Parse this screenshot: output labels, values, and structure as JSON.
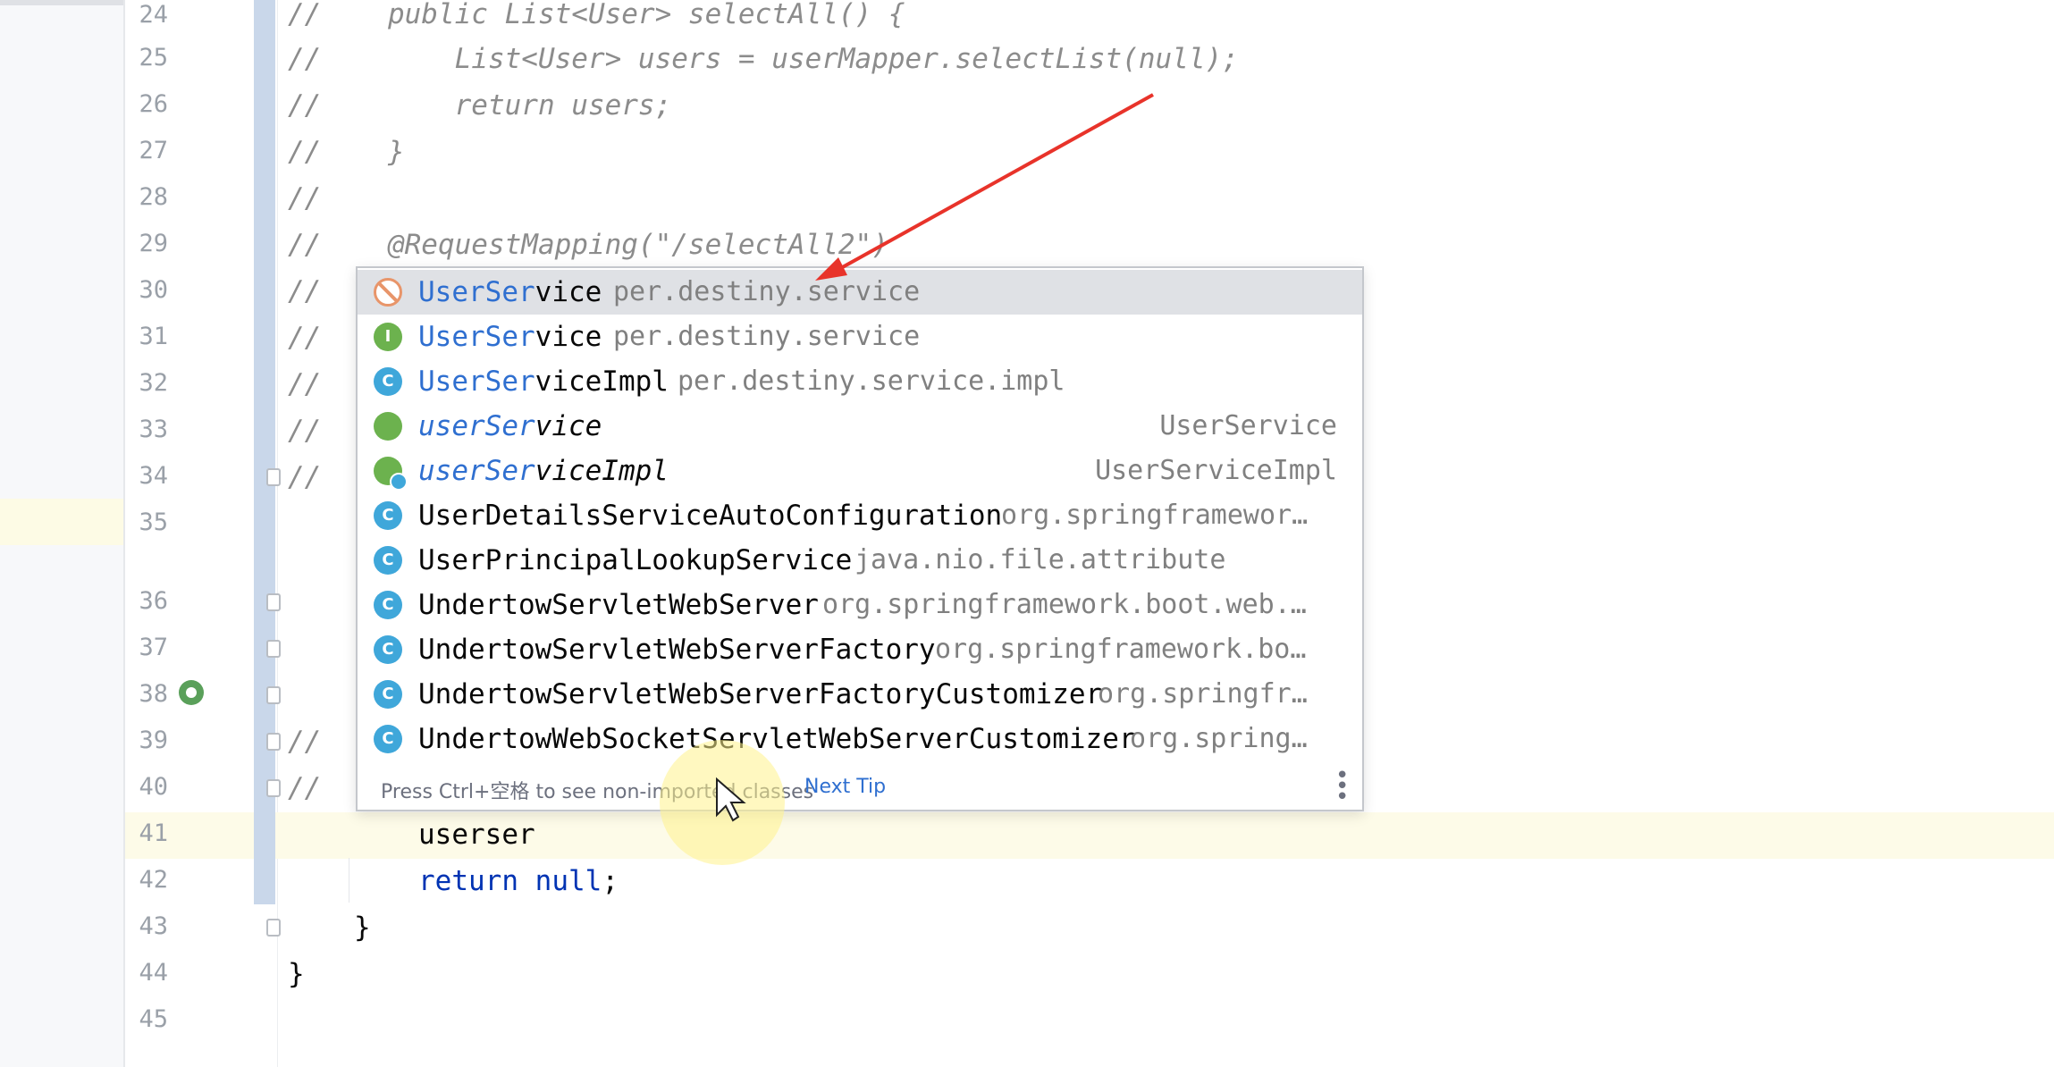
{
  "editor": {
    "line_numbers": [
      "24",
      "25",
      "26",
      "27",
      "28",
      "29",
      "30",
      "31",
      "32",
      "33",
      "34",
      "35",
      "36",
      "37",
      "38",
      "39",
      "40",
      "41",
      "42",
      "43",
      "44",
      "45"
    ],
    "lines": {
      "l24": "//    public List<User> selectAll() {",
      "l25": "//        List<User> users = userMapper.selectList(null);",
      "l26": "//        return users;",
      "l27": "//    }",
      "l28": "//",
      "l29": "//    @RequestMapping(\"/selectAll2\")",
      "l30": "//",
      "l31": "//",
      "l32": "//",
      "l33": "//",
      "l34": "//",
      "l39": "//",
      "l40": "//",
      "l41": "userser",
      "l42_kw1": "return",
      "l42_kw2": "null",
      "l42_end": ";",
      "l43": "}",
      "l44": "}"
    }
  },
  "completion": {
    "items": [
      {
        "match": "UserSer",
        "rest": "vice",
        "location": "per.destiny.service",
        "type": "",
        "icon": "banned-icon"
      },
      {
        "match": "UserSer",
        "rest": "vice",
        "location": "per.destiny.service",
        "type": "",
        "icon": "interface-icon"
      },
      {
        "match": "UserSer",
        "rest": "viceImpl",
        "location": "per.destiny.service.impl",
        "type": "",
        "icon": "class-icon"
      },
      {
        "match": "userSer",
        "rest": "vice",
        "location": "",
        "type": "UserService",
        "icon": "bean-field-icon"
      },
      {
        "match": "userSer",
        "rest": "viceImpl",
        "location": "",
        "type": "UserServiceImpl",
        "icon": "bean-class-icon"
      },
      {
        "name_html": "UserDetailsServiceAutoConfiguration",
        "location": "org.springframewor…",
        "icon": "class-icon"
      },
      {
        "name_html": "UserPrincipalLookupService",
        "location": "java.nio.file.attribute",
        "icon": "abstract-class-icon"
      },
      {
        "name_html": "UndertowServletWebServer",
        "location": "org.springframework.boot.web.…",
        "icon": "class-icon"
      },
      {
        "name_html": "UndertowServletWebServerFactory",
        "location": "org.springframework.bo…",
        "icon": "class-icon"
      },
      {
        "name_html": "UndertowServletWebServerFactoryCustomizer",
        "location": "org.springfr…",
        "icon": "class-icon"
      },
      {
        "name_html": "UndertowWebSocketServletWebServerCustomizer",
        "location": "org.spring…",
        "icon": "class-icon"
      }
    ],
    "footer": {
      "hint": "Press Ctrl+空格 to see non-imported classes",
      "next_tip": "Next Tip",
      "more_icon": "more-vertical-icon"
    }
  },
  "colors": {
    "match_highlight": "#2f6fd0",
    "selected_bg": "#dfe1e5",
    "arrow": "#e8332a"
  }
}
